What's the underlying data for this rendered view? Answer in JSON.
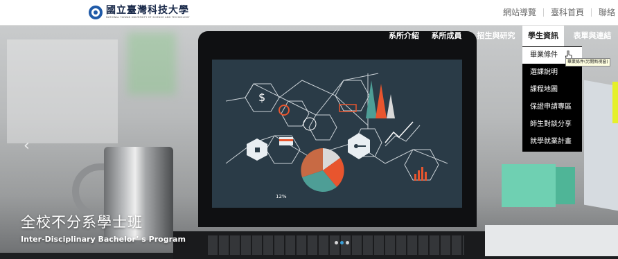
{
  "header": {
    "logo_cn": "國立臺灣科技大學",
    "logo_en": "NATIONAL TAIWAN UNIVERSITY OF SCIENCE AND TECHNOLOGY",
    "top_links": [
      "網站導覽",
      "臺科首頁",
      "聯絡"
    ]
  },
  "nav": {
    "items": [
      "系所介紹",
      "系所成員",
      "招生與研究",
      "學生資訊",
      "表單與連結"
    ],
    "active_index": 3
  },
  "dropdown": {
    "items": [
      "畢業條件",
      "選課說明",
      "課程地圖",
      "保證申請專區",
      "師生對談分享",
      "就學就業計畫"
    ],
    "hovered_index": 0,
    "tooltip": "畢業條件(另開新視窗)"
  },
  "hero": {
    "title_cn": "全校不分系學士班",
    "title_en": "Inter-Disciplinary Bachelor’ s Program",
    "prev_icon": "‹",
    "dots": 3,
    "active_dot": 1
  },
  "colors": {
    "nav_text": "#ffffff",
    "dropdown_bg": "#000000",
    "accent_blue": "#3aa0d8",
    "screen_bg": "#2a3b47"
  }
}
